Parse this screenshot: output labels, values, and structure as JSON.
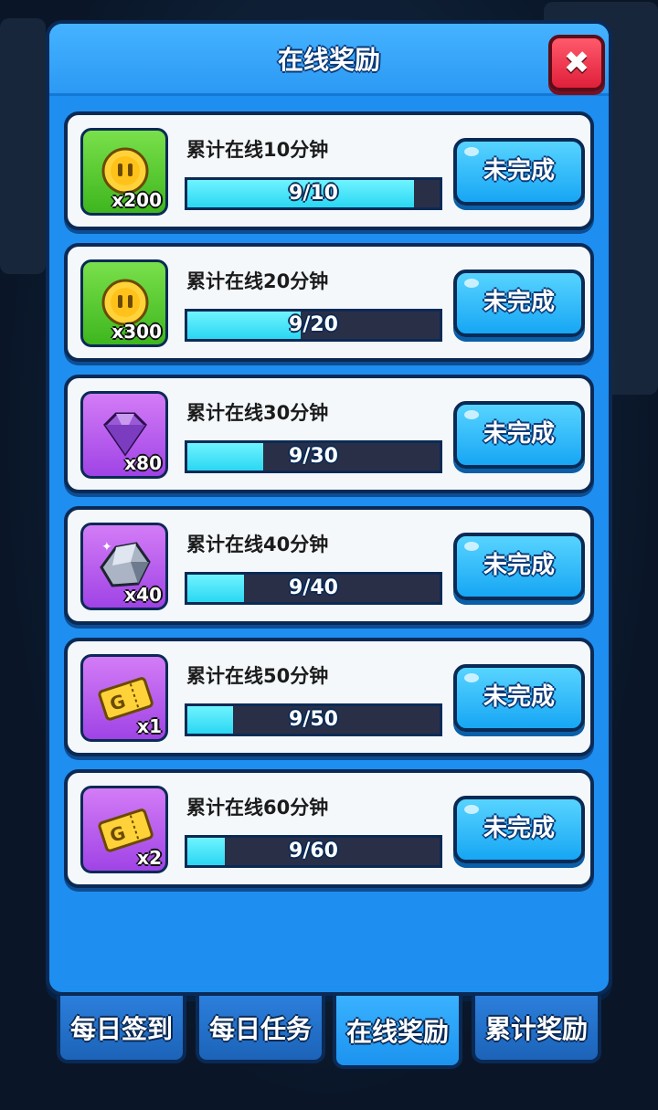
{
  "panel": {
    "title": "在线奖励",
    "close_symbol": "✖"
  },
  "rewards": [
    {
      "title": "累计在线10分钟",
      "count_label": "x200",
      "item": "gold-coin",
      "progress_text": "9/10",
      "progress": 0.9,
      "status": "未完成"
    },
    {
      "title": "累计在线20分钟",
      "count_label": "x300",
      "item": "gold-coin",
      "progress_text": "9/20",
      "progress": 0.45,
      "status": "未完成"
    },
    {
      "title": "累计在线30分钟",
      "count_label": "x80",
      "item": "purple-gem",
      "progress_text": "9/30",
      "progress": 0.3,
      "status": "未完成"
    },
    {
      "title": "累计在线40分钟",
      "count_label": "x40",
      "item": "silver-ore",
      "progress_text": "9/40",
      "progress": 0.225,
      "status": "未完成"
    },
    {
      "title": "累计在线50分钟",
      "count_label": "x1",
      "item": "gold-ticket",
      "progress_text": "9/50",
      "progress": 0.18,
      "status": "未完成"
    },
    {
      "title": "累计在线60分钟",
      "count_label": "x2",
      "item": "gold-ticket",
      "progress_text": "9/60",
      "progress": 0.15,
      "status": "未完成"
    }
  ],
  "tabs": [
    {
      "label": "每日签到",
      "active": false
    },
    {
      "label": "每日任务",
      "active": false
    },
    {
      "label": "在线奖励",
      "active": true
    },
    {
      "label": "累计奖励",
      "active": false
    }
  ],
  "colors": {
    "panel": "#1e8ff0",
    "button": "#17a6f4",
    "progress_fill": "#2ad7f2",
    "close": "#e01f3a"
  }
}
